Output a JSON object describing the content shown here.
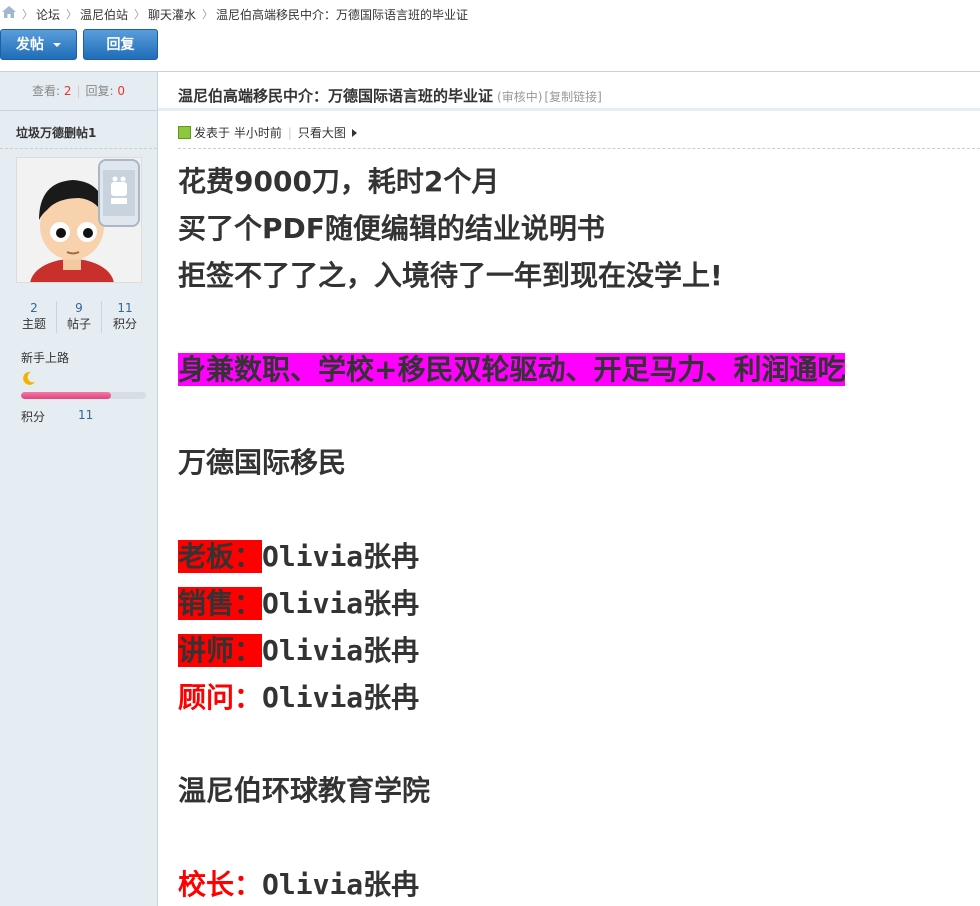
{
  "breadcrumb": {
    "items": [
      "论坛",
      "温尼伯站",
      "聊天灌水",
      "温尼伯高端移民中介：万德国际语言班的毕业证"
    ]
  },
  "toolbar": {
    "post_label": "发帖",
    "reply_label": "回复"
  },
  "thread_stats": {
    "views_label": "查看:",
    "views": "2",
    "replies_label": "回复:",
    "replies": "0"
  },
  "thread": {
    "title": "温尼伯高端移民中介：万德国际语言班的毕业证",
    "status": "(审核中)",
    "copy_link": "[复制链接]"
  },
  "author": {
    "name": "垃圾万德删帖1",
    "stats": [
      {
        "value": "2",
        "label": "主题"
      },
      {
        "value": "9",
        "label": "帖子"
      },
      {
        "value": "11",
        "label": "积分"
      }
    ],
    "rank": "新手上路",
    "progress_fraction": 0.72,
    "credit_label": "积分",
    "credit_value": "11"
  },
  "post_meta": {
    "posted": "发表于 半小时前",
    "author_only": "只看大图"
  },
  "post": {
    "l1": "花费9000刀，耗时2个月",
    "l2": "买了个PDF随便编辑的结业说明书",
    "l3": "拒签不了了之，入境待了一年到现在没学上!",
    "l4": "身兼数职、学校+移民双轮驱动、开足马力、利润通吃",
    "l5": "万德国际移民",
    "roles": [
      {
        "label": "老板：",
        "value": "Olivia张冉"
      },
      {
        "label": "销售：",
        "value": "Olivia张冉"
      },
      {
        "label": "讲师：",
        "value": "Olivia张冉"
      },
      {
        "label": "顾问：",
        "value": "Olivia张冉"
      }
    ],
    "l6": "温尼伯环球教育学院",
    "principal": {
      "label": "校长：",
      "value": "Olivia张冉"
    }
  },
  "colors": {
    "highlight_magenta": "#ff00ff",
    "highlight_red": "#ff0000",
    "accent_blue": "#1f6db8"
  }
}
